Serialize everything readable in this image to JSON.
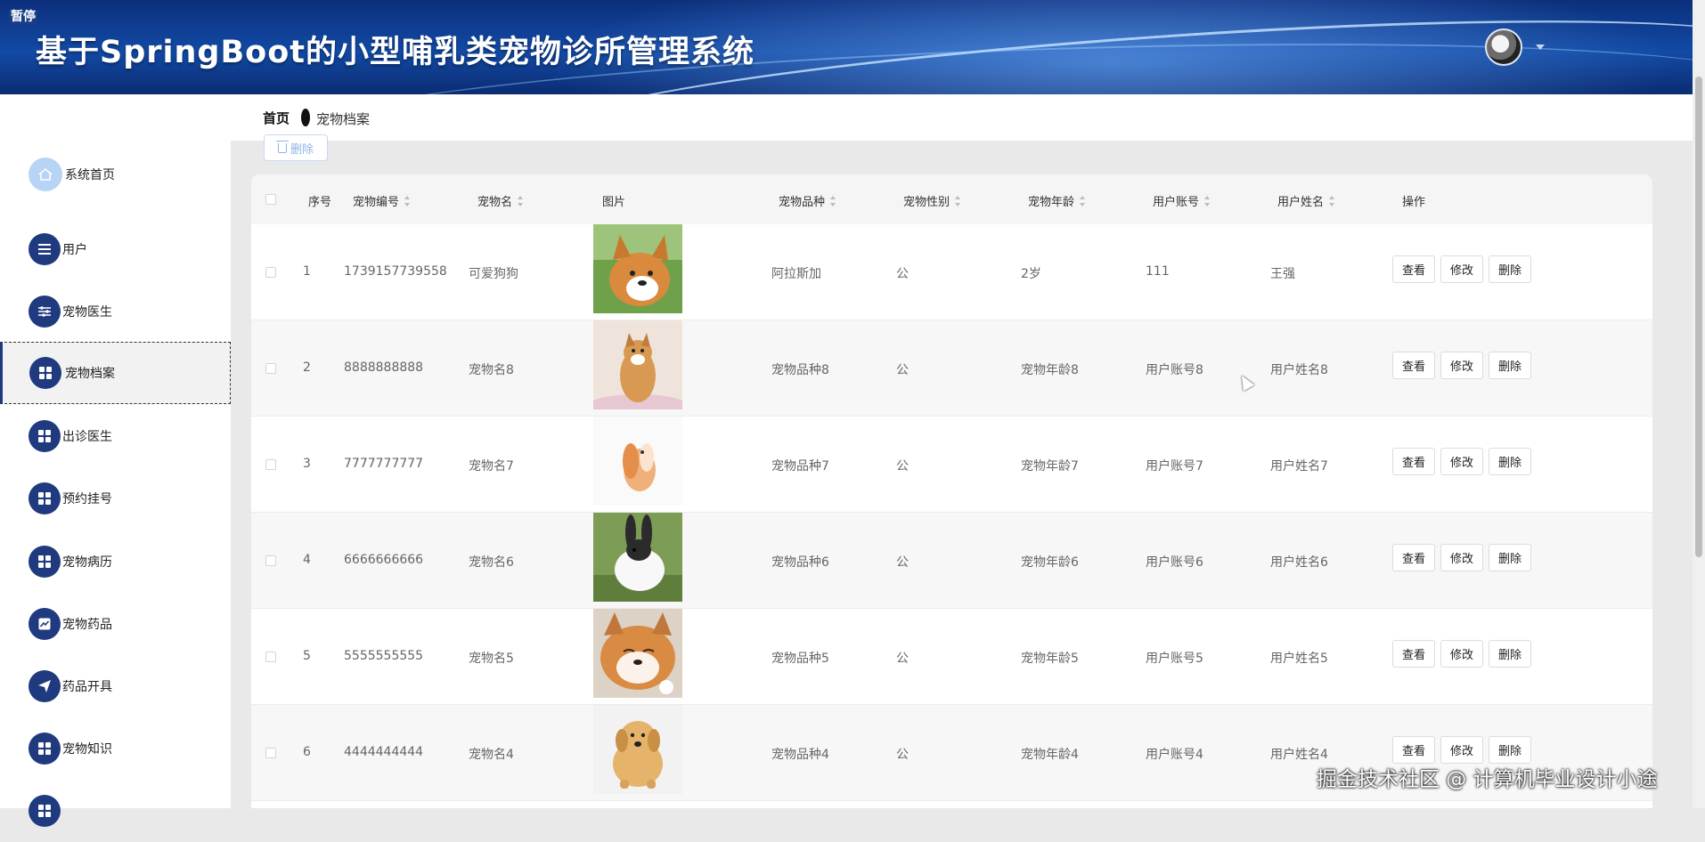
{
  "overlay": {
    "pause_label": "暂停",
    "watermark": "掘金技术社区 @ 计算机毕业设计小途"
  },
  "header": {
    "title": "基于SpringBoot的小型哺乳类宠物诊所管理系统"
  },
  "sidebar": {
    "items": [
      {
        "label": "系统首页",
        "icon": "home-icon"
      },
      {
        "label": "用户",
        "icon": "list-icon"
      },
      {
        "label": "宠物医生",
        "icon": "sliders-icon"
      },
      {
        "label": "宠物档案",
        "icon": "grid-icon",
        "active": true
      },
      {
        "label": "出诊医生",
        "icon": "grid-icon"
      },
      {
        "label": "预约挂号",
        "icon": "grid-icon"
      },
      {
        "label": "宠物病历",
        "icon": "grid-icon"
      },
      {
        "label": "宠物药品",
        "icon": "chart-icon"
      },
      {
        "label": "药品开具",
        "icon": "send-icon"
      },
      {
        "label": "宠物知识",
        "icon": "grid-icon"
      }
    ]
  },
  "breadcrumb": {
    "home": "首页",
    "current": "宠物档案"
  },
  "toolbar": {
    "delete_label": "删除"
  },
  "table": {
    "columns": [
      "序号",
      "宠物编号",
      "宠物名",
      "图片",
      "宠物品种",
      "宠物性别",
      "宠物年龄",
      "用户账号",
      "用户姓名",
      "操作"
    ],
    "actions": {
      "view": "查看",
      "edit": "修改",
      "delete": "删除"
    },
    "rows": [
      {
        "index": "1",
        "pet_no": "1739157739558",
        "name": "可爱狗狗",
        "breed": "阿拉斯加",
        "gender": "公",
        "age": "2岁",
        "account": "111",
        "owner": "王强",
        "image": "corgi"
      },
      {
        "index": "2",
        "pet_no": "8888888888",
        "name": "宠物名8",
        "breed": "宠物品种8",
        "gender": "公",
        "age": "宠物年龄8",
        "account": "用户账号8",
        "owner": "用户姓名8",
        "image": "shiba"
      },
      {
        "index": "3",
        "pet_no": "7777777777",
        "name": "宠物名7",
        "breed": "宠物品种7",
        "gender": "公",
        "age": "宠物年龄7",
        "account": "用户账号7",
        "owner": "用户姓名7",
        "image": "lop-rabbit"
      },
      {
        "index": "4",
        "pet_no": "6666666666",
        "name": "宠物名6",
        "breed": "宠物品种6",
        "gender": "公",
        "age": "宠物年龄6",
        "account": "用户账号6",
        "owner": "用户姓名6",
        "image": "bw-rabbit"
      },
      {
        "index": "5",
        "pet_no": "5555555555",
        "name": "宠物名5",
        "breed": "宠物品种5",
        "gender": "公",
        "age": "宠物年龄5",
        "account": "用户账号5",
        "owner": "用户姓名5",
        "image": "akita"
      },
      {
        "index": "6",
        "pet_no": "4444444444",
        "name": "宠物名4",
        "breed": "宠物品种4",
        "gender": "公",
        "age": "宠物年龄4",
        "account": "用户账号4",
        "owner": "用户姓名4",
        "image": "golden-puppy"
      }
    ]
  },
  "colors": {
    "header_blue": "#124aa5",
    "sidebar_icon": "#1f3a7e",
    "delete_btn": "#8fb4e8"
  }
}
